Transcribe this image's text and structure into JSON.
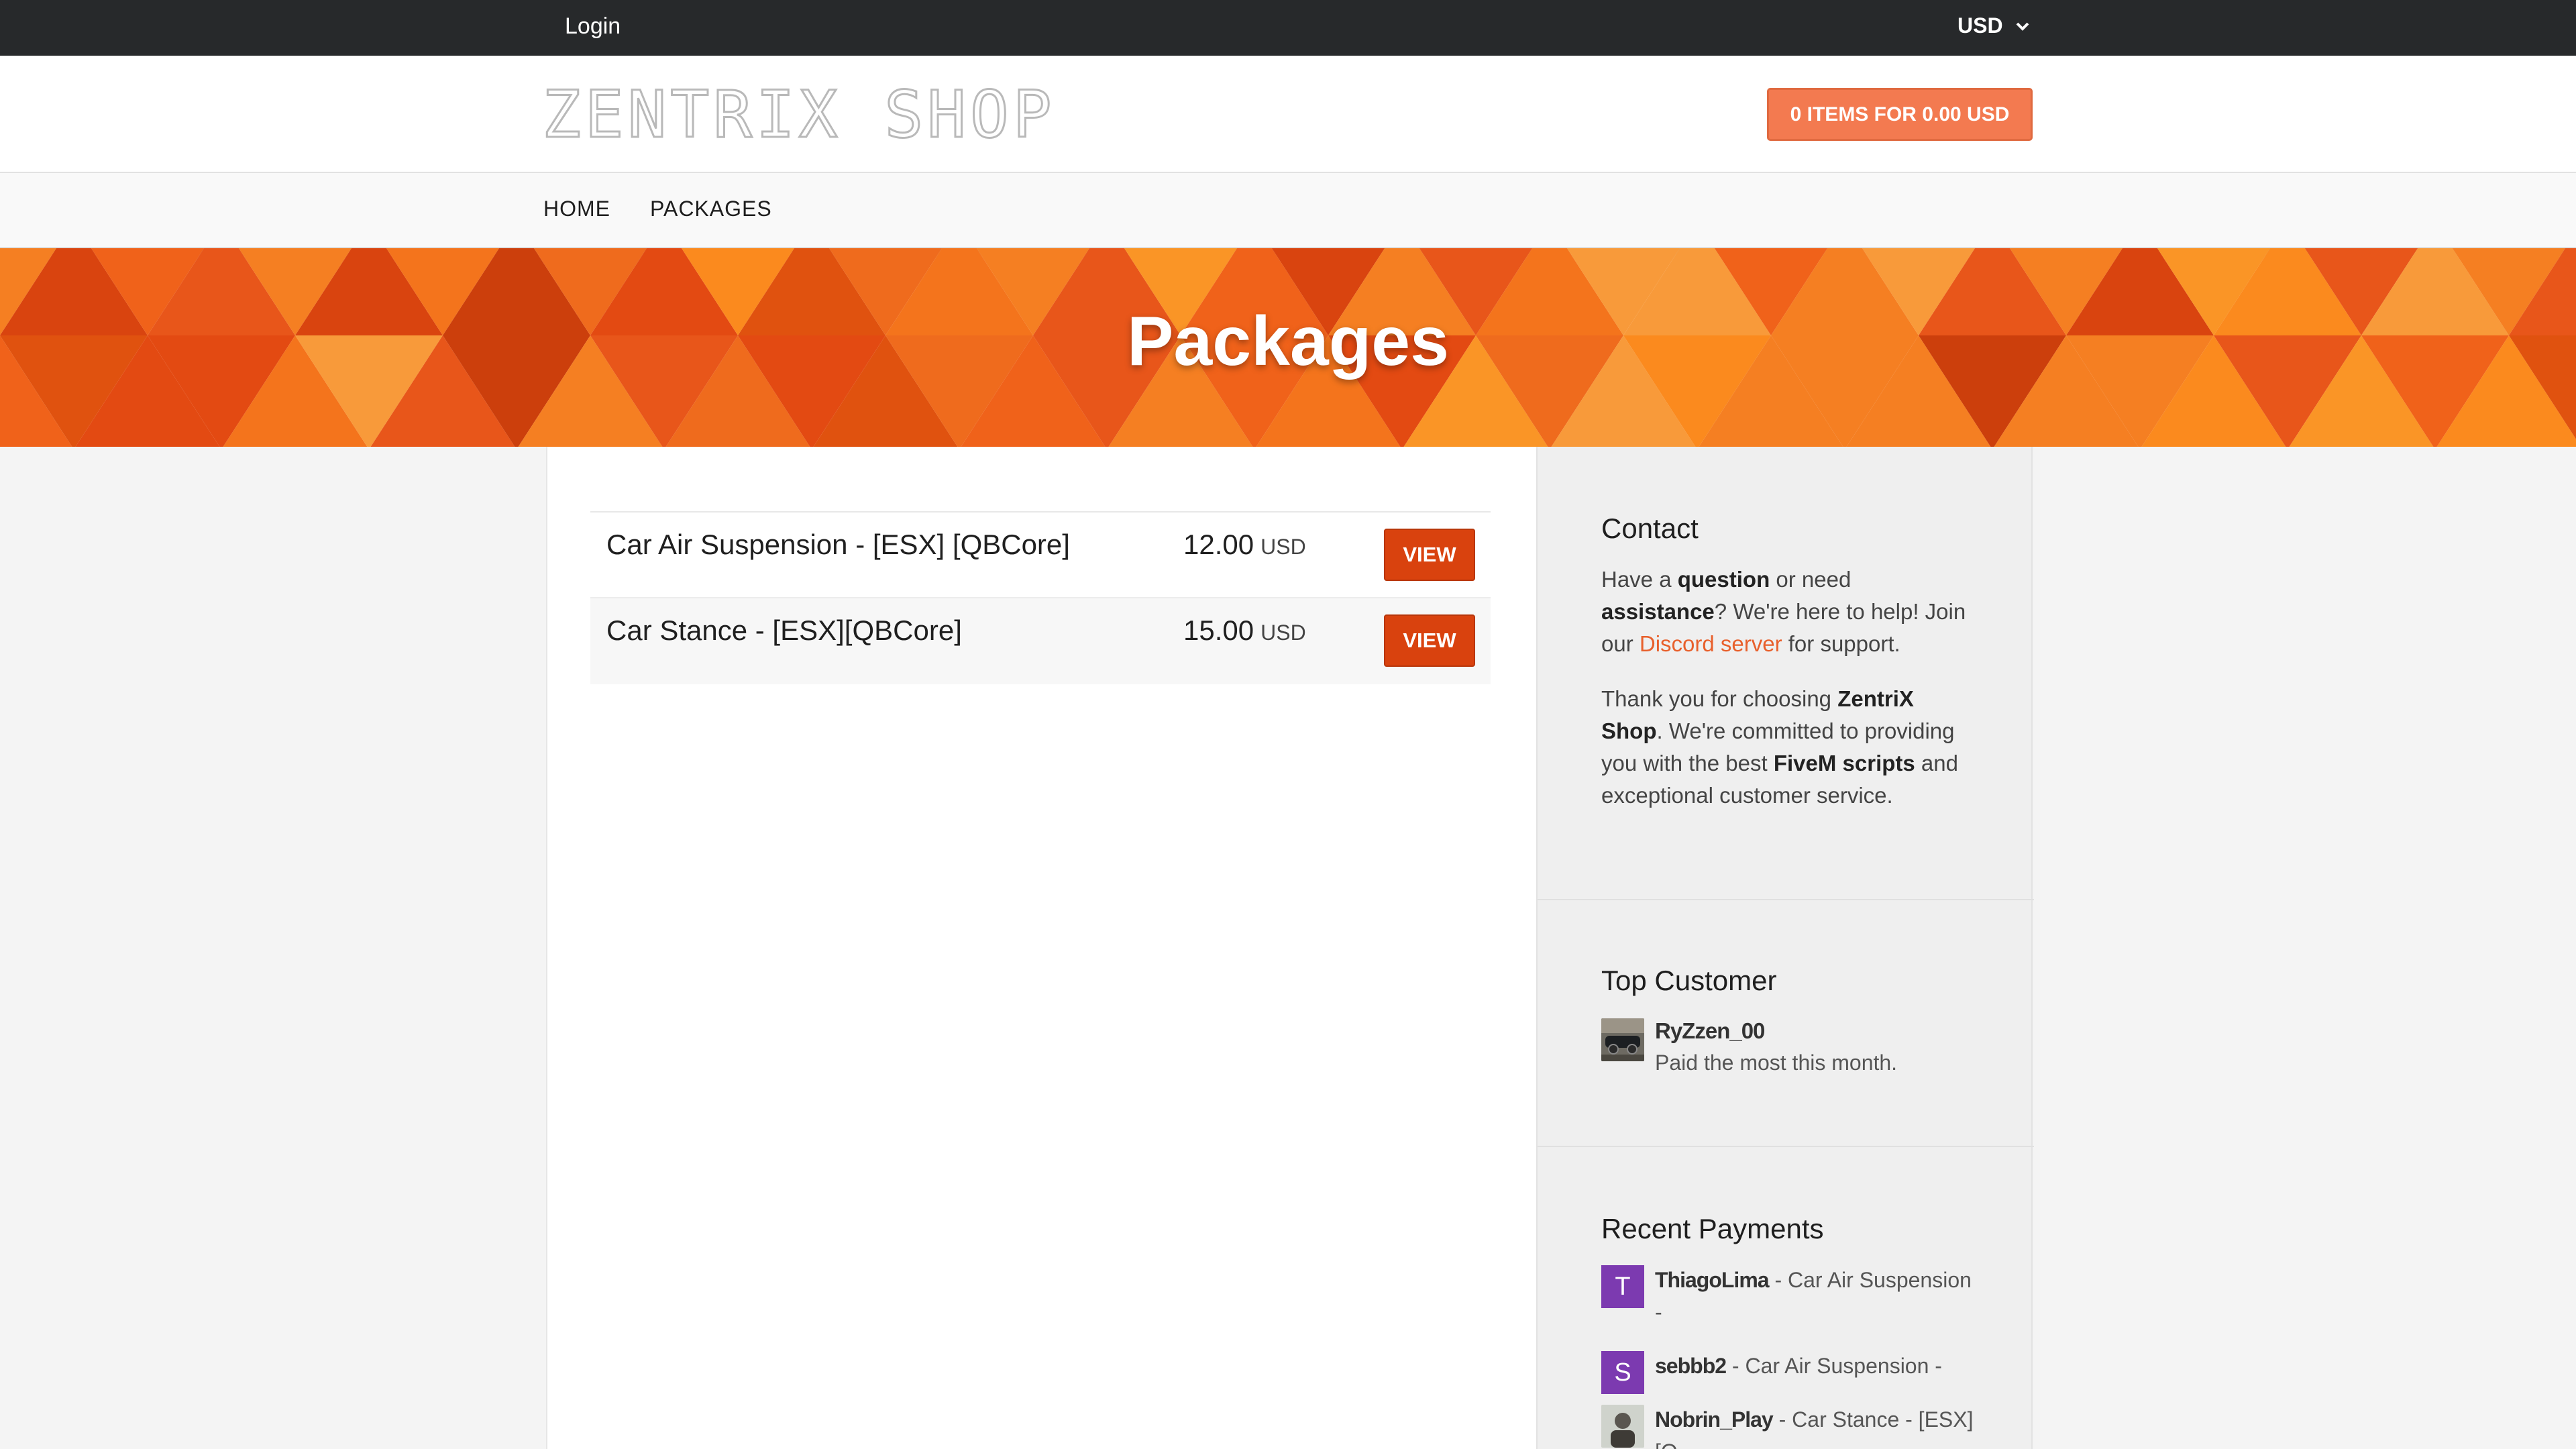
{
  "topbar": {
    "login": "Login",
    "currency": "USD"
  },
  "header": {
    "logo": "ZENTRIX SHOP",
    "cart": "0 ITEMS FOR 0.00 USD"
  },
  "nav": {
    "items": [
      {
        "label": "HOME"
      },
      {
        "label": "PACKAGES"
      }
    ]
  },
  "banner": {
    "title": "Packages"
  },
  "packages": [
    {
      "name": "Car Air Suspension - [ESX] [QBCore]",
      "price": "12.00",
      "unit": "USD",
      "button": "VIEW"
    },
    {
      "name": "Car Stance - [ESX][QBCore]",
      "price": "15.00",
      "unit": "USD",
      "button": "VIEW"
    }
  ],
  "sidebar": {
    "contact": {
      "title": "Contact",
      "p1": {
        "a": "Have a ",
        "b": "question",
        "c": " or need ",
        "d": "assistance",
        "e": "? We're here to help! Join our ",
        "link": "Discord server",
        "f": " for support."
      },
      "p2": {
        "a": "Thank you for choosing ",
        "b": "ZentriX Shop",
        "c": ". We're committed to providing you with the best ",
        "d": "FiveM scripts",
        "e": " and exceptional customer service."
      }
    },
    "top_customer": {
      "title": "Top Customer",
      "name": "RyZzen_00",
      "subtitle": "Paid the most this month."
    },
    "recent_payments": {
      "title": "Recent Payments",
      "items": [
        {
          "avatar": "T",
          "user": "ThiagoLima",
          "detail": " - Car Air Suspension -"
        },
        {
          "avatar": "S",
          "user": "sebbb2",
          "detail": " - Car Air Suspension -"
        },
        {
          "avatar": "",
          "user": "Nobrin_Play",
          "detail": " - Car Stance - [ESX] [Q"
        }
      ]
    }
  },
  "colors": {
    "accent": "#f37a50",
    "button": "#d9420e",
    "topbar": "#27292b",
    "avatar": "#7c3ab0",
    "link": "#e8602c"
  },
  "icons": {
    "currency_toggle": "chevron-down-icon"
  }
}
